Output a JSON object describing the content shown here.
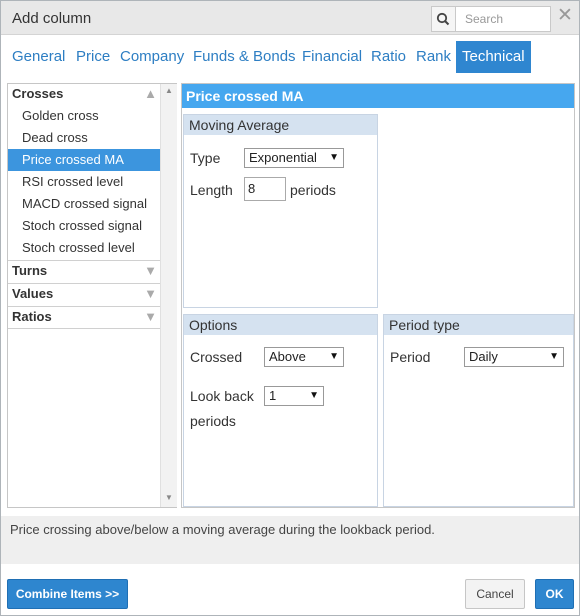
{
  "dialog": {
    "title": "Add column"
  },
  "search": {
    "placeholder": "Search"
  },
  "tabs": [
    {
      "label": "General"
    },
    {
      "label": "Price"
    },
    {
      "label": "Company"
    },
    {
      "label": "Funds & Bonds"
    },
    {
      "label": "Financial"
    },
    {
      "label": "Ratio"
    },
    {
      "label": "Rank"
    },
    {
      "label": "Technical",
      "active": true
    }
  ],
  "sidebar": {
    "groups": [
      {
        "label": "Crosses",
        "expanded": true,
        "items": [
          {
            "label": "Golden cross"
          },
          {
            "label": "Dead cross"
          },
          {
            "label": "Price crossed MA",
            "selected": true
          },
          {
            "label": "RSI crossed level"
          },
          {
            "label": "MACD crossed signal"
          },
          {
            "label": "Stoch crossed signal"
          },
          {
            "label": "Stoch crossed level"
          }
        ]
      },
      {
        "label": "Turns",
        "expanded": false
      },
      {
        "label": "Values",
        "expanded": false
      },
      {
        "label": "Ratios",
        "expanded": false
      }
    ]
  },
  "panel": {
    "title": "Price crossed MA",
    "moving_average": {
      "title": "Moving Average",
      "type_label": "Type",
      "type_value": "Exponential",
      "length_label": "Length",
      "length_value": "8",
      "length_unit": "periods"
    },
    "options": {
      "title": "Options",
      "crossed_label": "Crossed",
      "crossed_value": "Above",
      "lookback_label": "Look back",
      "lookback_value": "1",
      "lookback_unit": "periods"
    },
    "period_type": {
      "title": "Period type",
      "period_label": "Period",
      "period_value": "Daily"
    }
  },
  "status": {
    "text": "Price crossing above/below a moving average during the lookback period."
  },
  "footer": {
    "combine_label": "Combine Items >>",
    "cancel_label": "Cancel",
    "ok_label": "OK"
  },
  "colors": {
    "accent": "#2f86d0",
    "selection": "#3c95de",
    "header": "#46a7ef",
    "box_title": "#d5e2f0"
  }
}
